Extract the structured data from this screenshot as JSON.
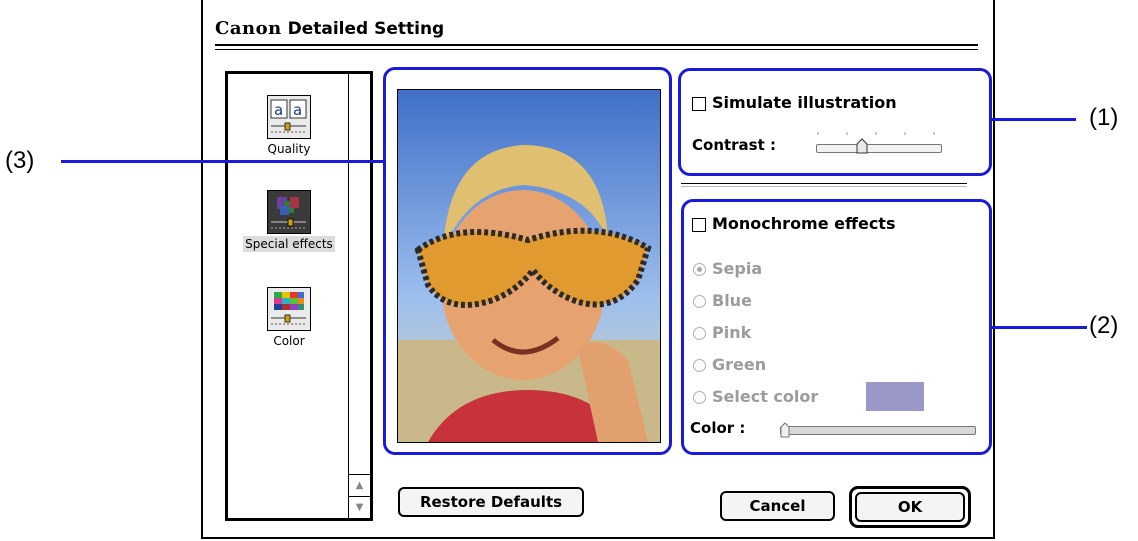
{
  "window": {
    "brand": "Canon",
    "title": "Detailed Setting"
  },
  "sidebar": {
    "items": [
      {
        "label": "Quality",
        "icon": "quality-icon"
      },
      {
        "label": "Special effects",
        "icon": "special-effects-icon",
        "selected": true
      },
      {
        "label": "Color",
        "icon": "color-icon"
      }
    ]
  },
  "preview": {
    "icon": "photo-preview-child-sunglasses"
  },
  "illustration": {
    "simulate_label": "Simulate illustration",
    "simulate_checked": false,
    "contrast_label": "Contrast :",
    "contrast_level": 0.35
  },
  "monochrome": {
    "label": "Monochrome effects",
    "checked": false,
    "options": [
      {
        "label": "Sepia",
        "selected": true
      },
      {
        "label": "Blue",
        "selected": false
      },
      {
        "label": "Pink",
        "selected": false
      },
      {
        "label": "Green",
        "selected": false
      },
      {
        "label": "Select color",
        "selected": false
      }
    ],
    "select_color_swatch": "#9a97c9",
    "color_label": "Color :",
    "color_level": 0.0
  },
  "buttons": {
    "restore_defaults": "Restore Defaults",
    "cancel": "Cancel",
    "ok": "OK"
  },
  "callouts": {
    "one": "(1)",
    "two": "(2)",
    "three": "(3)"
  },
  "colors": {
    "callout": "#1a1adb",
    "disabled_text": "#9c9c9c"
  }
}
